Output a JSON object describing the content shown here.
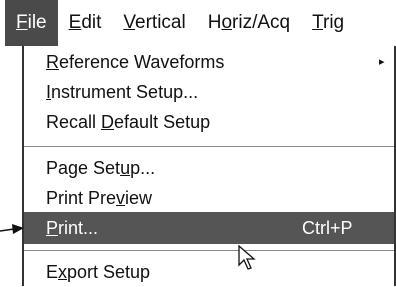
{
  "menubar": {
    "items": [
      {
        "pre": "",
        "ul": "F",
        "post": "ile"
      },
      {
        "pre": "",
        "ul": "E",
        "post": "dit"
      },
      {
        "pre": "",
        "ul": "V",
        "post": "ertical"
      },
      {
        "pre": "H",
        "ul": "o",
        "post": "riz/Acq"
      },
      {
        "pre": "",
        "ul": "T",
        "post": "rig"
      }
    ]
  },
  "file_menu": {
    "items": [
      {
        "pre": "",
        "ul": "R",
        "post": "eference Waveforms",
        "shortcut": "",
        "submenu": true
      },
      {
        "pre": "",
        "ul": "I",
        "post": "nstrument Setup...",
        "shortcut": ""
      },
      {
        "pre": "Recall ",
        "ul": "D",
        "post": "efault Setup",
        "shortcut": ""
      },
      {
        "pre": "Page Set",
        "ul": "u",
        "post": "p...",
        "shortcut": ""
      },
      {
        "pre": "Print Pre",
        "ul": "v",
        "post": "iew",
        "shortcut": ""
      },
      {
        "pre": "",
        "ul": "P",
        "post": "rint...",
        "shortcut": "Ctrl+P"
      },
      {
        "pre": "E",
        "ul": "x",
        "post": "port Setup",
        "shortcut": ""
      }
    ]
  },
  "icons": {
    "submenu_arrow": "▸"
  },
  "colors": {
    "active_menu_bg": "#4a4a4a",
    "highlight_bg": "#555555"
  }
}
